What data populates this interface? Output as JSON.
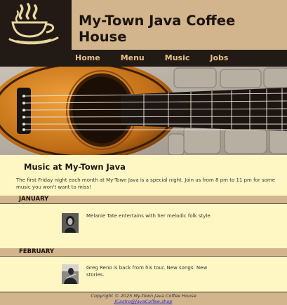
{
  "header": {
    "site_title": "My-Town Java Coffee House"
  },
  "nav": {
    "items": [
      "Home",
      "Menu",
      "Music",
      "Jobs"
    ]
  },
  "main": {
    "heading": "Music at My-Town Java",
    "intro": "The first Friday night each month at My-Town Java is a special night. Join us from 8 pm to 11 pm for some music you won't want to miss!",
    "months": [
      {
        "name": "JANUARY",
        "event": "Melanie Tate entertains with her melodic folk style."
      },
      {
        "name": "FEBRUARY",
        "event": "Greg Reno is back from his tour. New songs. New stories."
      }
    ]
  },
  "footer": {
    "copyright": "Copyright © 2025 My-Town Java Coffee House",
    "email": "JCastro@JavaCoffee.shop"
  },
  "colors": {
    "tan": "#d2b58c",
    "dark_brown": "#221a14",
    "cream": "#fff7c3",
    "nav_text": "#e6c18c"
  },
  "icons": {
    "logo": "coffee-cup-icon"
  }
}
